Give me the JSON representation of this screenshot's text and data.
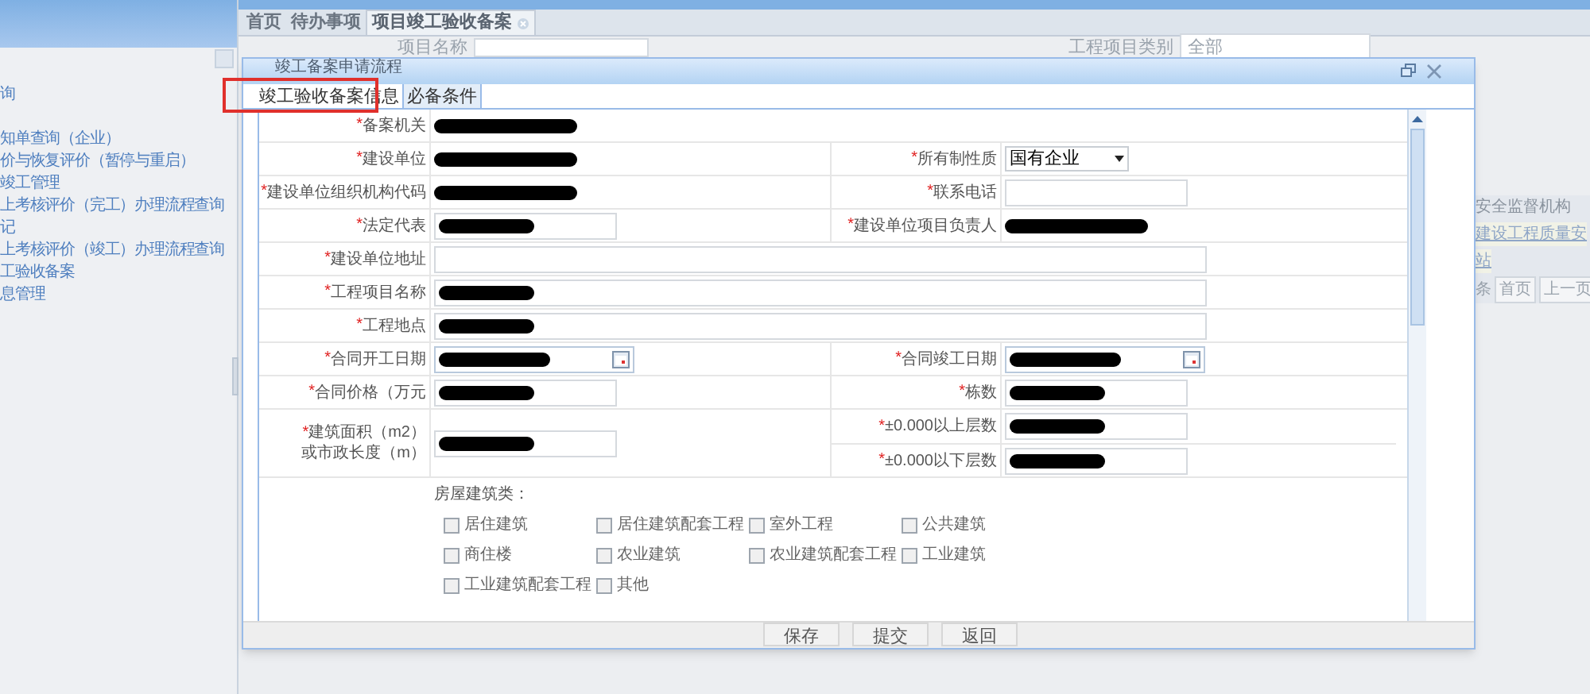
{
  "sidebar": {
    "items": [
      "询",
      "知单查询（企业）",
      "价与恢复评价（暂停与重启）",
      "竣工管理",
      "上考核评价（完工）办理流程查询",
      "记",
      "上考核评价（竣工）办理流程查询",
      "工验收备案",
      "息管理"
    ]
  },
  "main_tabs": [
    {
      "label": "首页",
      "selected": false,
      "closable": false
    },
    {
      "label": "待办事项",
      "selected": false,
      "closable": false
    },
    {
      "label": "项目竣工验收备案",
      "selected": true,
      "closable": true
    }
  ],
  "background": {
    "search_labels": [
      "项目名称",
      "工程项目类别"
    ],
    "category_value": "全部",
    "column_header": "安全监督机构",
    "link": "建设工程质量安",
    "link_tail": "站",
    "pager_fragment": "条",
    "pager_buttons": [
      "首页",
      "上一页"
    ]
  },
  "dialog": {
    "title": "竣工备案申请流程",
    "tabs": [
      {
        "label": "竣工验收备案信息",
        "selected": true
      },
      {
        "label": "必备条件",
        "selected": false
      }
    ],
    "rows": [
      {
        "fields": [
          {
            "mark": "*",
            "label": [
              "备案机关"
            ],
            "kind": "text",
            "redacted": true
          }
        ]
      },
      {
        "fields": [
          {
            "mark": "*",
            "label": [
              "建设单位"
            ],
            "kind": "text",
            "redacted": true
          },
          {
            "mark": "*",
            "label": [
              "所有制性质"
            ],
            "kind": "select",
            "value": "国有企业"
          }
        ]
      },
      {
        "fields": [
          {
            "mark": "*",
            "label": [
              "建设单位组织机构代码"
            ],
            "kind": "text",
            "redacted": true
          },
          {
            "mark": "*",
            "label": [
              "联系电话"
            ],
            "kind": "input",
            "redacted": false
          }
        ]
      },
      {
        "fields": [
          {
            "mark": "*",
            "label": [
              "法定代表"
            ],
            "kind": "input",
            "redacted": true
          },
          {
            "mark": "*",
            "label": [
              "建设单位项目负责人"
            ],
            "kind": "text",
            "redacted": true
          }
        ]
      },
      {
        "fields": [
          {
            "mark": "*",
            "label": [
              "建设单位地址"
            ],
            "kind": "input",
            "redacted": false,
            "wide": true
          }
        ]
      },
      {
        "fields": [
          {
            "mark": "*",
            "label": [
              "工程项目名称"
            ],
            "kind": "input",
            "redacted": true,
            "wide": true
          }
        ]
      },
      {
        "fields": [
          {
            "mark": "*",
            "label": [
              "工程地点"
            ],
            "kind": "input",
            "redacted": true,
            "wide": true
          }
        ]
      },
      {
        "fields": [
          {
            "mark": "*",
            "label": [
              "合同开工日期"
            ],
            "kind": "date",
            "redacted": true
          },
          {
            "mark": "*",
            "label": [
              "合同竣工日期"
            ],
            "kind": "date",
            "redacted": true
          }
        ]
      },
      {
        "fields": [
          {
            "mark": "*",
            "label": [
              "合同价格（万元"
            ],
            "kind": "input",
            "redacted": true
          },
          {
            "mark": "*",
            "label": [
              "栋数"
            ],
            "kind": "input",
            "redacted": true
          }
        ]
      },
      {
        "fields": [
          {
            "mark": "*",
            "label": [
              "建筑面积（m2）",
              "或市政长度（m）"
            ],
            "kind": "input",
            "redacted": true
          },
          {
            "kind": "stack",
            "fields": [
              {
                "mark": "*",
                "label": [
                  "±0.000以上层数"
                ],
                "kind": "input",
                "redacted": true
              },
              {
                "mark": "*",
                "label": [
                  "±0.000以下层数"
                ],
                "kind": "input",
                "redacted": true
              }
            ]
          }
        ]
      }
    ],
    "building_types": {
      "label": "房屋建筑类：",
      "options": [
        {
          "label": "居住建筑",
          "checked": false
        },
        {
          "label": "居住建筑配套工程",
          "checked": false
        },
        {
          "label": "室外工程",
          "checked": false
        },
        {
          "label": "公共建筑",
          "checked": false
        },
        {
          "label": "商住楼",
          "checked": false
        },
        {
          "label": "农业建筑",
          "checked": false
        },
        {
          "label": "农业建筑配套工程",
          "checked": false
        },
        {
          "label": "工业建筑",
          "checked": false
        },
        {
          "label": "工业建筑配套工程",
          "checked": false
        },
        {
          "label": "其他",
          "checked": false
        }
      ]
    },
    "buttons": [
      "保存",
      "提交",
      "返回"
    ]
  }
}
